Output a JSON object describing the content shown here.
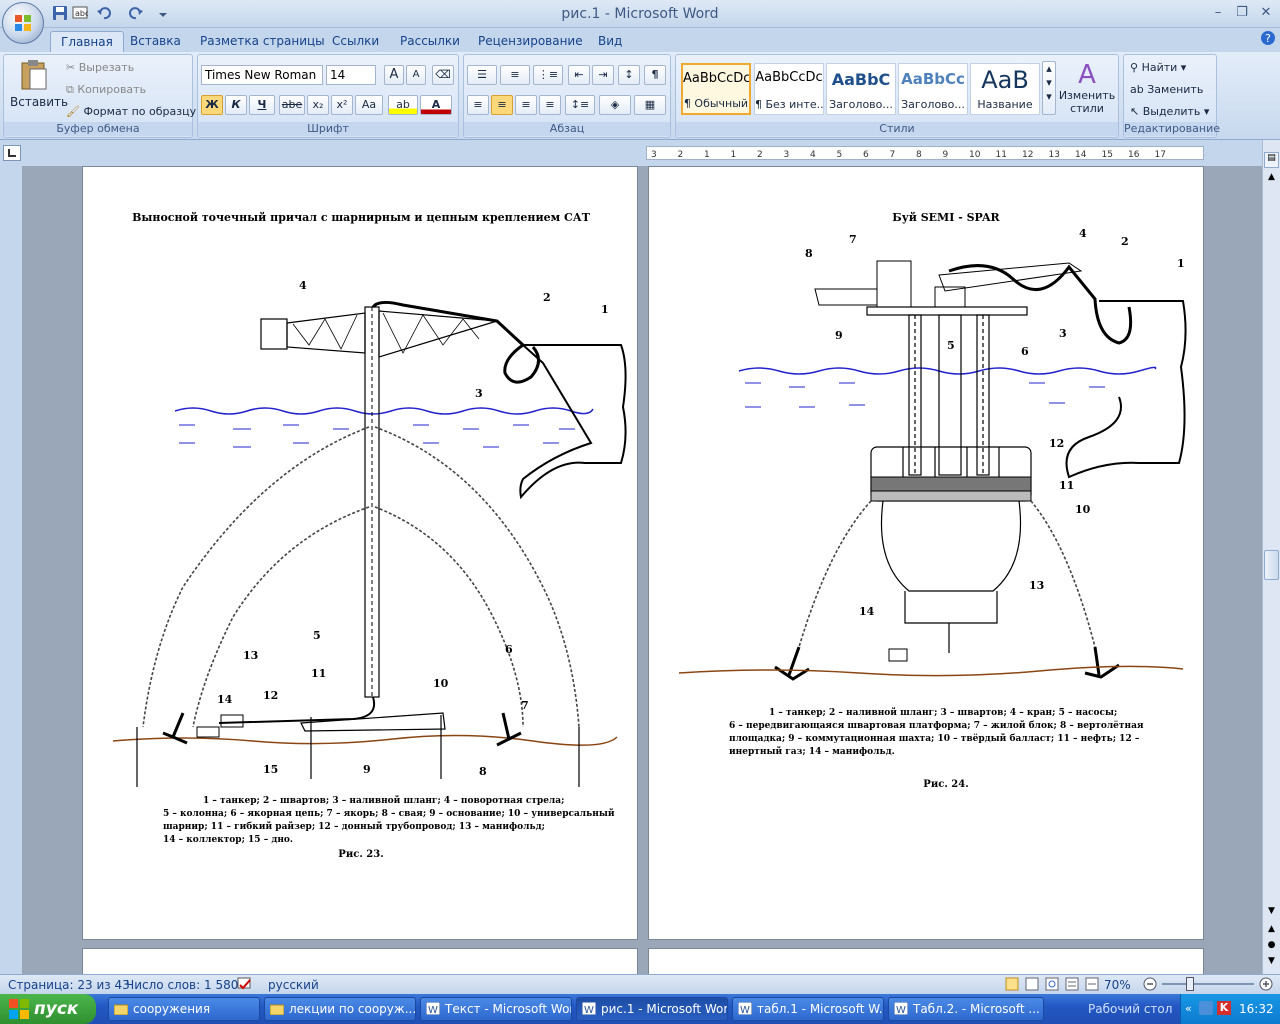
{
  "window": {
    "title": "рис.1 - Microsoft Word"
  },
  "tabs": [
    "Главная",
    "Вставка",
    "Разметка страницы",
    "Ссылки",
    "Рассылки",
    "Рецензирование",
    "Вид"
  ],
  "clipboard": {
    "paste": "Вставить",
    "cut": "Вырезать",
    "copy": "Копировать",
    "format_painter": "Формат по образцу",
    "label": "Буфер обмена"
  },
  "font": {
    "family": "Times New Roman",
    "size": "14",
    "label": "Шрифт",
    "bold": "Ж",
    "italic": "К",
    "underline": "Ч",
    "strike": "abe",
    "sub": "x₂",
    "sup": "x²",
    "case": "Aa",
    "grow": "A",
    "shrink": "A"
  },
  "paragraph": {
    "label": "Абзац",
    "pilcrow": "¶"
  },
  "styles": {
    "label": "Стили",
    "items": [
      {
        "sample": "AaBbCcDc",
        "name": "¶ Обычный"
      },
      {
        "sample": "AaBbCcDc",
        "name": "¶ Без инте..."
      },
      {
        "sample": "AaBbC",
        "name": "Заголово..."
      },
      {
        "sample": "AaBbCc",
        "name": "Заголово..."
      },
      {
        "sample": "AaB",
        "name": "Название"
      }
    ],
    "change": "Изменить стили"
  },
  "editing": {
    "find": "Найти",
    "replace": "Заменить",
    "select": "Выделить",
    "label": "Редактирование"
  },
  "ruler": {
    "numbers": [
      "3",
      "2",
      "1",
      "1",
      "2",
      "3",
      "4",
      "5",
      "6",
      "7",
      "8",
      "9",
      "10",
      "11",
      "12",
      "13",
      "14",
      "15",
      "16",
      "17"
    ]
  },
  "page1": {
    "title": "Выносной точечный причал с шарнирным и цепным креплением САТ",
    "labels": [
      "1",
      "2",
      "3",
      "4",
      "5",
      "6",
      "7",
      "8",
      "9",
      "10",
      "11",
      "12",
      "13",
      "14",
      "15"
    ],
    "caption": [
      "1 – танкер; 2 – швартов; 3 – наливной шланг; 4 – поворотная стрела;",
      "5 – колонна; 6 – якорная цепь; 7 – якорь; 8 – свая; 9 – основание; 10 – универсальный",
      "шарнир; 11 – гибкий райзер; 12 – донный трубопровод; 13 – манифольд;",
      "14 – коллектор; 15 – дно."
    ],
    "figure": "Рис. 23."
  },
  "page2": {
    "title": "Буй SEMI - SPAR",
    "labels": [
      "1",
      "2",
      "3",
      "4",
      "5",
      "6",
      "7",
      "8",
      "9",
      "10",
      "11",
      "12",
      "13",
      "14"
    ],
    "caption": [
      "1 – танкер; 2 – наливной шланг; 3 – швартов; 4 – кран; 5 – насосы;",
      "6 – передвигающаяся швартовая платформа; 7 – жилой блок; 8 – вертолётная",
      "площадка; 9 – коммутационная шахта; 10 – твёрдый балласт; 11 – нефть; 12 –",
      "инертный газ; 14 – манифольд."
    ],
    "figure": "Рис. 24."
  },
  "status": {
    "page": "Страница: 23 из 43",
    "words": "Число слов: 1 580",
    "language": "русский",
    "zoom": "70%"
  },
  "taskbar": {
    "start": "пуск",
    "tasks": [
      "сооружения",
      "лекции по сооруж...",
      "Текст - Microsoft Word",
      "рис.1 - Microsoft Word",
      "табл.1 - Microsoft W...",
      "Табл.2. - Microsoft ..."
    ],
    "desktop": "Рабочий стол",
    "clock": "16:32"
  },
  "colors": {
    "water": "#2222cc",
    "seabed": "#8b4513",
    "accent": "#f0a830"
  }
}
